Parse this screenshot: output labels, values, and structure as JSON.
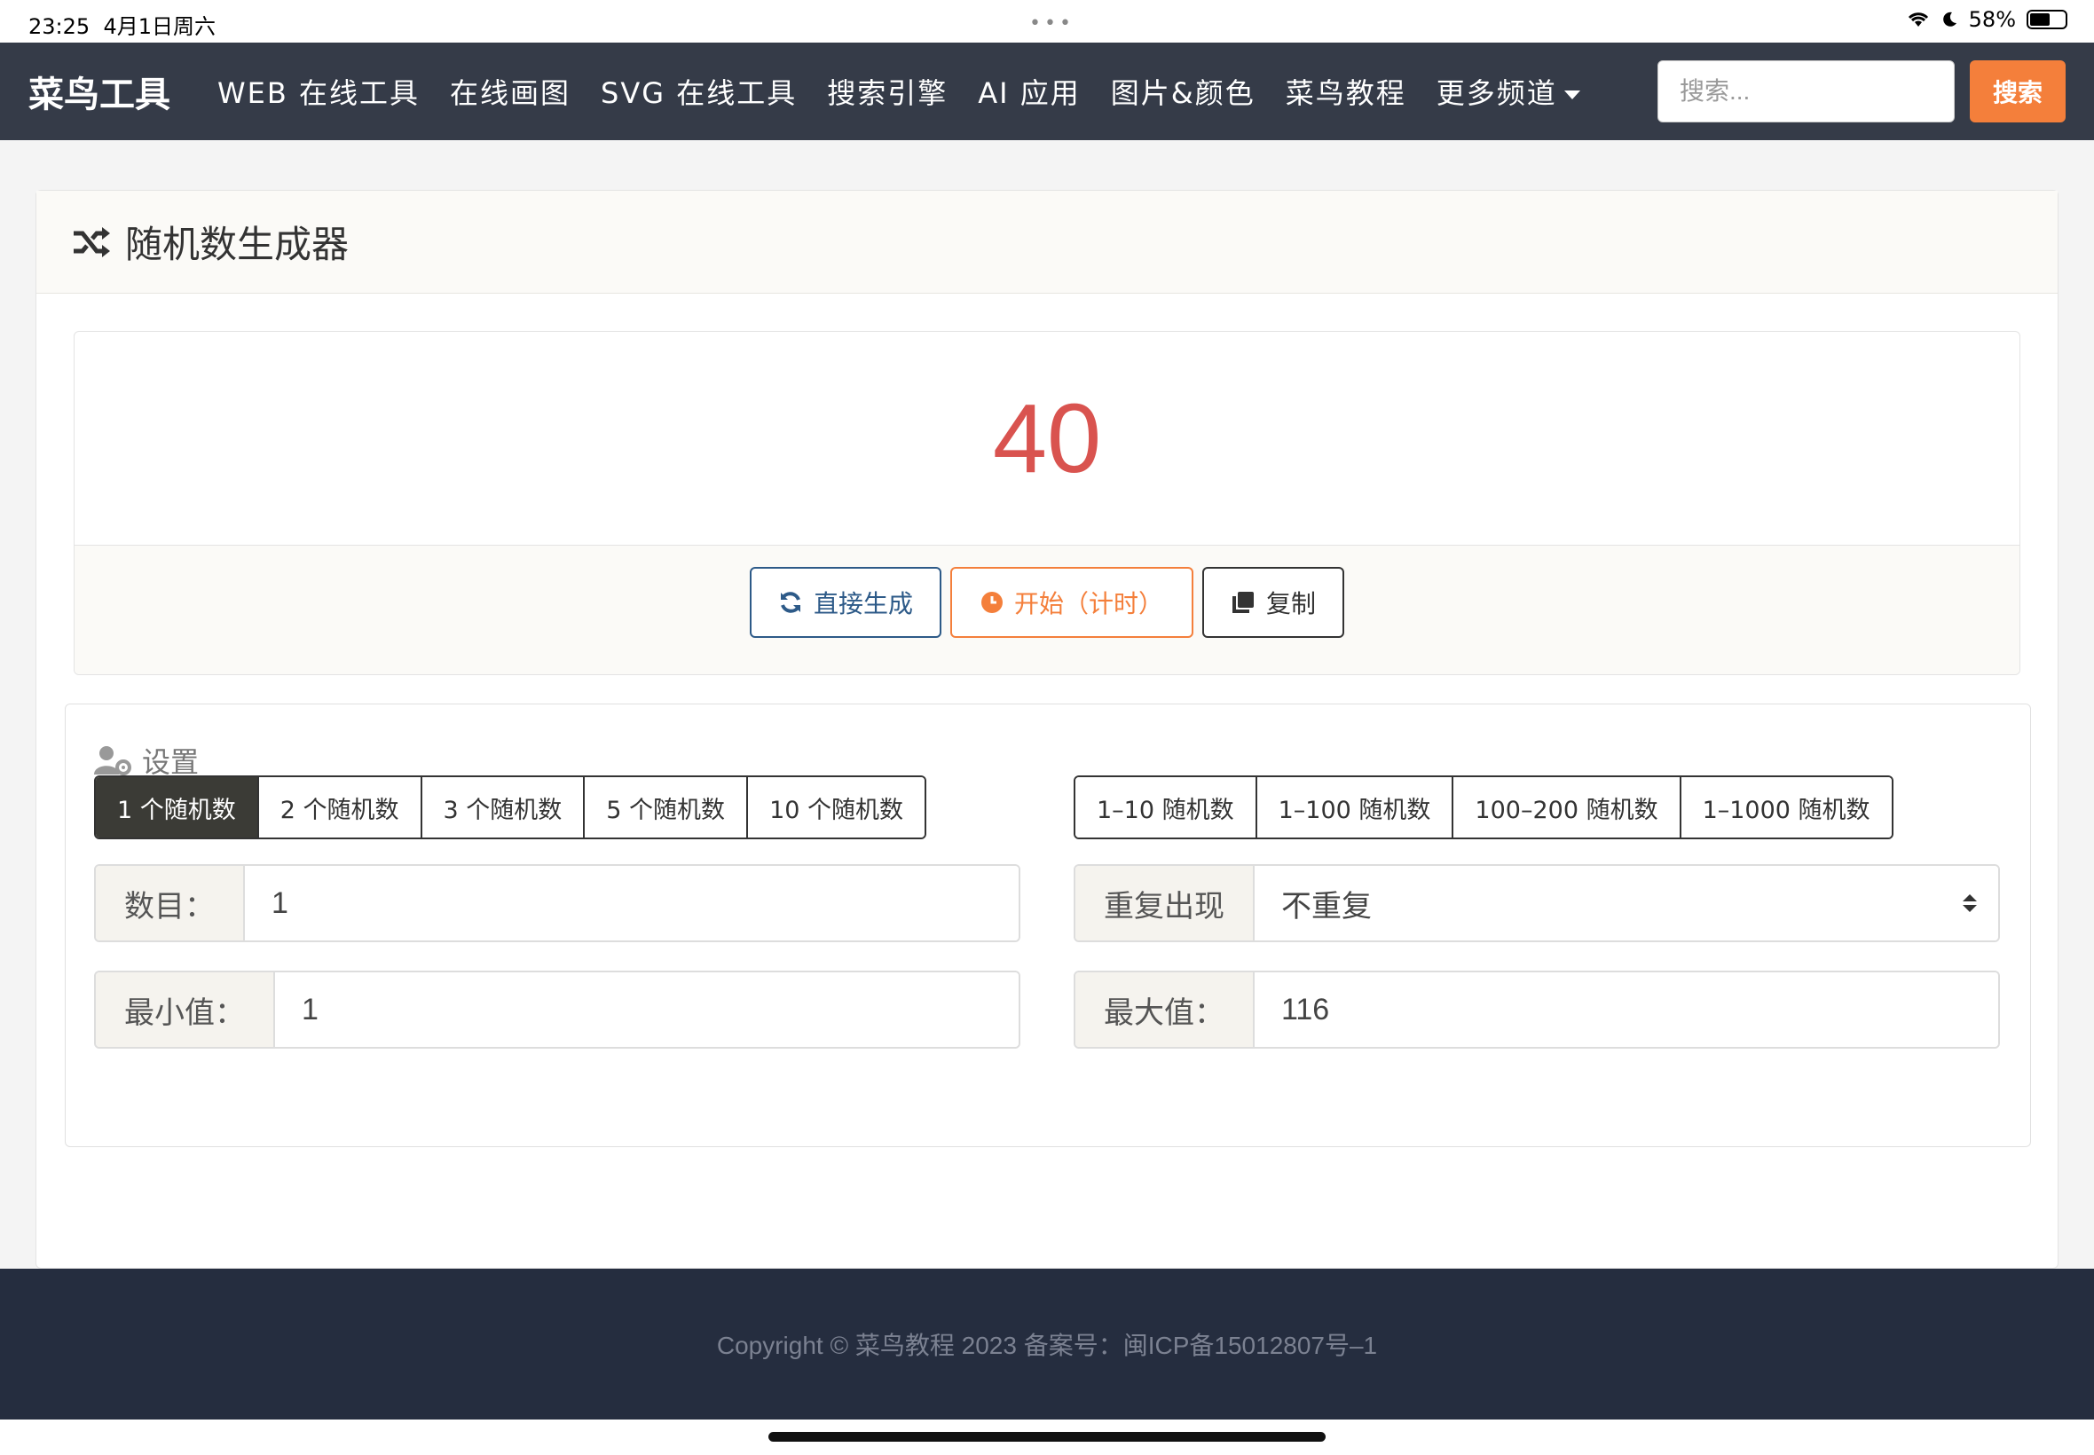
{
  "status_bar": {
    "time": "23:25",
    "date": "4月1日周六",
    "dots": "•••",
    "battery": "58%"
  },
  "nav": {
    "brand": "菜鸟工具",
    "items": [
      "WEB 在线工具",
      "在线画图",
      "SVG 在线工具",
      "搜索引擎",
      "AI 应用",
      "图片&颜色",
      "菜鸟教程",
      "更多频道"
    ],
    "search_placeholder": "搜索...",
    "search_button": "搜索"
  },
  "card": {
    "title": "随机数生成器"
  },
  "result": {
    "value": "40",
    "buttons": {
      "generate": "直接生成",
      "start": "开始（计时）",
      "copy": "复制"
    }
  },
  "settings": {
    "title": "设置",
    "count_presets": [
      "1 个随机数",
      "2 个随机数",
      "3 个随机数",
      "5 个随机数",
      "10 个随机数"
    ],
    "range_presets": [
      "1–10 随机数",
      "1–100 随机数",
      "100–200 随机数",
      "1–1000 随机数"
    ],
    "count_label": "数目：",
    "count_value": "1",
    "repeat_label": "重复出现",
    "repeat_value": "不重复",
    "min_label": "最小值：",
    "min_value": "1",
    "max_label": "最大值：",
    "max_value": "116"
  },
  "footer": {
    "text": "Copyright © 菜鸟教程 2023 备案号：闽ICP备15012807号–1"
  },
  "colors": {
    "navbar": "#353b48",
    "accent": "#f47f3b",
    "result": "#d9534f",
    "footer": "#252d3f"
  }
}
